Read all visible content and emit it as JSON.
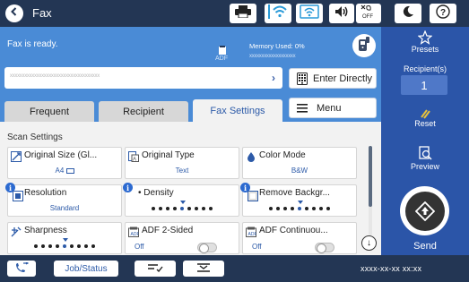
{
  "app": {
    "title": "Fax"
  },
  "status": {
    "message": "Fax is ready.",
    "adf_label": "ADF",
    "memory_label": "Memory Used: 0%",
    "memory_bar_text": "xxxxxxxxxxxxxxxxxxx"
  },
  "recipient_field": {
    "placeholder": "xxxxxxxxxxxxxxxxxxxxxxxxxxxxxxxxxxxxx"
  },
  "buttons": {
    "enter_directly": "Enter Directly",
    "menu": "Menu"
  },
  "tabs": [
    {
      "label": "Frequent"
    },
    {
      "label": "Recipient"
    },
    {
      "label": "Fax Settings",
      "active": true
    }
  ],
  "section_title": "Scan Settings",
  "settings": {
    "original_size": {
      "label": "Original Size (Gl...",
      "value": "A4"
    },
    "original_type": {
      "label": "Original Type",
      "value": "Text"
    },
    "color_mode": {
      "label": "Color Mode",
      "value": "B&W"
    },
    "resolution": {
      "label": "Resolution",
      "value": "Standard"
    },
    "density": {
      "label": "Density",
      "level": 0
    },
    "remove_background": {
      "label": "Remove Backgr...",
      "level": 0
    },
    "sharpness": {
      "label": "Sharpness",
      "level": 0
    },
    "adf_2sided": {
      "label": "ADF 2-Sided",
      "value": "Off"
    },
    "adf_continuous": {
      "label": "ADF Continuou...",
      "value": "Off"
    }
  },
  "right_panel": {
    "presets": "Presets",
    "recipients_label": "Recipient(s)",
    "recipients_count": "1",
    "reset": "Reset",
    "preview": "Preview",
    "send": "Send"
  },
  "bottom": {
    "job_status": "Job/Status",
    "datetime": "xxxx-xx-xx xx:xx"
  },
  "colors": {
    "topbar": "#233654",
    "header": "#4a8bd6",
    "accent": "#2c5aa8",
    "right_panel": "#2b55a8"
  },
  "icons": [
    "back-arrow-icon",
    "printer-icon",
    "wifi-icon",
    "wifi-direct-icon",
    "speaker-icon",
    "eco-off-icon",
    "moon-icon",
    "help-icon",
    "fax-phone-icon",
    "address-book-icon",
    "menu-icon",
    "star-icon",
    "reset-icon",
    "preview-icon",
    "send-icon",
    "fax-history-icon",
    "collapse-icon",
    "expand-icon"
  ]
}
